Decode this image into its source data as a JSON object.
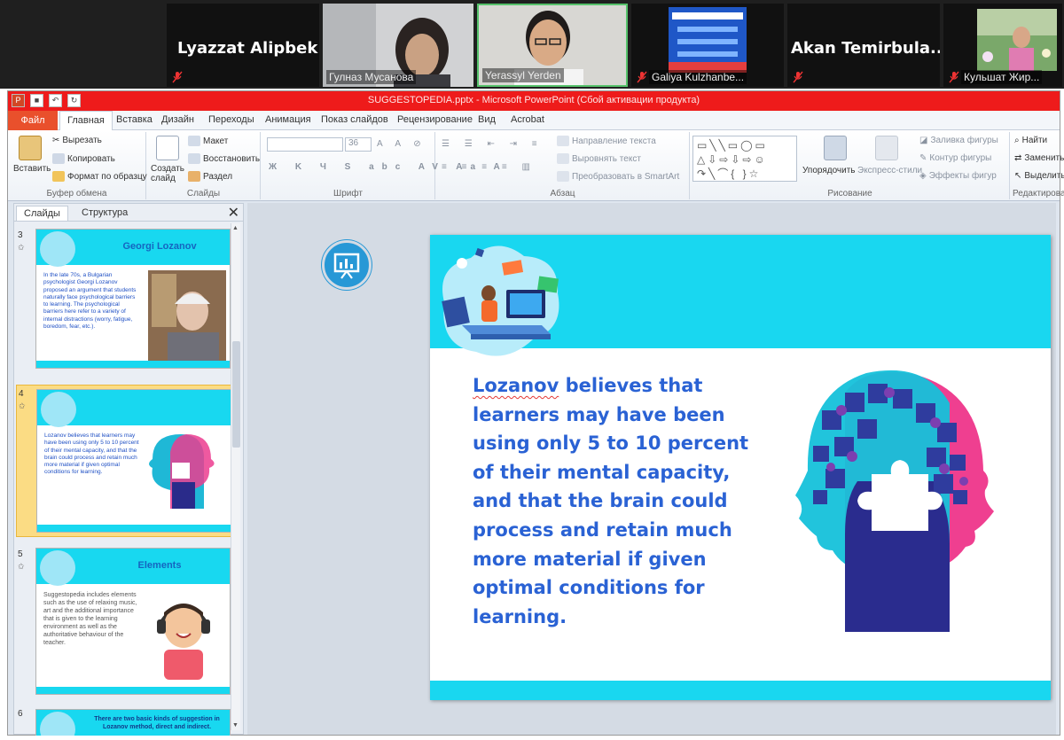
{
  "participants": {
    "lyazzat": "Lyazzat  Alipbek...",
    "gulnaz": "Гулназ Мусанова",
    "yerassyl": "Yerassyl Yerden",
    "galiya": "Galiya Kulzhanbe...",
    "akan": "Akan  Temirbula...",
    "kulshat": "Кульшат Жир..."
  },
  "window": {
    "title": "SUGGESTOPEDIA.pptx  -  Microsoft PowerPoint (Сбой активации продукта)"
  },
  "ribbon_tabs": {
    "file": "Файл",
    "home": "Главная",
    "insert": "Вставка",
    "design": "Дизайн",
    "transitions": "Переходы",
    "animation": "Анимация",
    "slideshow": "Показ слайдов",
    "review": "Рецензирование",
    "view": "Вид",
    "acrobat": "Acrobat"
  },
  "ribbon": {
    "paste": "Вставить",
    "cut": "Вырезать",
    "copy": "Копировать",
    "format_painter": "Формат по образцу",
    "clipboard_group": "Буфер обмена",
    "new_slide": "Создать слайд",
    "layout": "Макет",
    "reset": "Восстановить",
    "section": "Раздел",
    "slides_group": "Слайды",
    "font_size": "36",
    "font_group": "Шрифт",
    "text_direction": "Направление текста",
    "align_text": "Выровнять текст",
    "smartart": "Преобразовать в SmartArt",
    "paragraph_group": "Абзац",
    "arrange": "Упорядочить",
    "quick_styles": "Экспресс-стили",
    "shape_fill": "Заливка фигуры",
    "shape_outline": "Контур фигуры",
    "shape_effects": "Эффекты фигур",
    "drawing_group": "Рисование",
    "find": "Найти",
    "replace": "Заменить",
    "select": "Выделить",
    "editing_group": "Редактирова"
  },
  "slides_panel": {
    "tab_slides": "Слайды",
    "tab_outline": "Структура",
    "close": "✕",
    "thumbs": [
      {
        "number": "3",
        "title": "Georgi Lozanov",
        "text": "In the late 70s, a Bulgarian psychologist Georgi Lozanov proposed an argument that students naturally face psychological barriers to learning. The psychological barriers here refer to a variety of internal distractions (worry, fatigue, boredom, fear, etc.)."
      },
      {
        "number": "4",
        "title": "",
        "text": "Lozanov believes that learners may have been using only 5 to 10 percent of their mental capacity, and that the brain could process and retain much more material if given optimal conditions for learning."
      },
      {
        "number": "5",
        "title": "Elements",
        "text": "Suggestopedia includes elements such as the use of relaxing music, art and the additional importance that is given to the learning environment as well as the authoritative behaviour of the teacher."
      },
      {
        "number": "6",
        "title": "There are two basic kinds of suggestion in Lozanov method, direct and indirect.",
        "text": ""
      }
    ]
  },
  "slide": {
    "lead_word": "Lozanov",
    "text": " believes that learners may have been using only 5 to 10 percent of their mental capacity, and that the brain could process and retain much more material if given optimal conditions for learning."
  },
  "icons": {
    "presentation": "presentation-chart-icon",
    "mic": "microphone-muted-icon"
  },
  "colors": {
    "slide_band": "#19d7f0",
    "slide_text": "#2a62d4",
    "ppt_titlebar": "#ee1b1b",
    "file_tab": "#e9502c"
  }
}
